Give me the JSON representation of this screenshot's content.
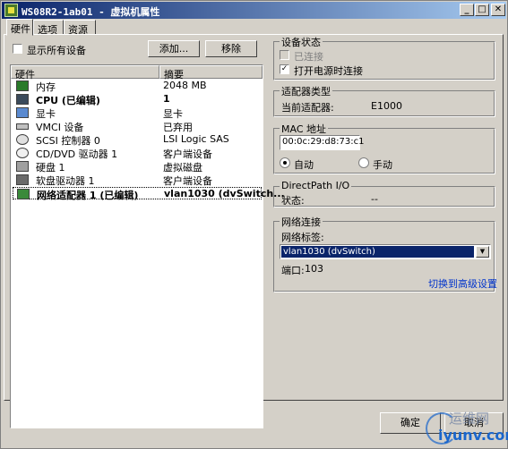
{
  "window": {
    "title": "WS08R2-1ab01 - 虚拟机属性",
    "min": "_",
    "max": "□",
    "close": "✕"
  },
  "tabs": [
    {
      "label": "硬件"
    },
    {
      "label": "选项"
    },
    {
      "label": "资源"
    }
  ],
  "hardware": {
    "show_all_label": "显示所有设备",
    "add_label": "添加...",
    "remove_label": "移除",
    "col_hardware": "硬件",
    "col_summary": "摘要",
    "rows": [
      {
        "name": "内存",
        "summary": "2048 MB",
        "icon": "memory-icon"
      },
      {
        "name": "CPU (已编辑)",
        "summary": "1",
        "icon": "cpu-icon"
      },
      {
        "name": "显卡",
        "summary": "显卡",
        "icon": "display-icon"
      },
      {
        "name": "VMCI 设备",
        "summary": "已弃用",
        "icon": "vmci-icon"
      },
      {
        "name": "SCSI 控制器 0",
        "summary": "LSI Logic SAS",
        "icon": "scsi-icon"
      },
      {
        "name": "CD/DVD 驱动器 1",
        "summary": "客户端设备",
        "icon": "cdrom-icon"
      },
      {
        "name": "硬盘 1",
        "summary": "虚拟磁盘",
        "icon": "disk-icon"
      },
      {
        "name": "软盘驱动器 1",
        "summary": "客户端设备",
        "icon": "floppy-icon"
      },
      {
        "name": "网络适配器 1 (已编辑)",
        "summary": "vlan1030 (dvSwitch...",
        "icon": "network-icon"
      }
    ]
  },
  "device_status": {
    "title": "设备状态",
    "connected": "已连接",
    "power_on_connect": "打开电源时连接"
  },
  "adapter_type": {
    "title": "适配器类型",
    "current_label": "当前适配器:",
    "current_value": "E1000"
  },
  "mac": {
    "title": "MAC 地址",
    "value": "00:0c:29:d8:73:c1",
    "auto": "自动",
    "manual": "手动"
  },
  "directpath": {
    "title": "DirectPath I/O",
    "status_label": "状态:",
    "status_value": "--"
  },
  "network": {
    "title": "网络连接",
    "label_label": "网络标签:",
    "selected": "vlan1030 (dvSwitch)",
    "port_label": "端口:",
    "port_value": "103",
    "advanced_link": "切换到高级设置"
  },
  "footer": {
    "ok": "确定",
    "cancel": "取消"
  },
  "watermark": {
    "cn": "运维网",
    "url": "iyunv.com"
  }
}
